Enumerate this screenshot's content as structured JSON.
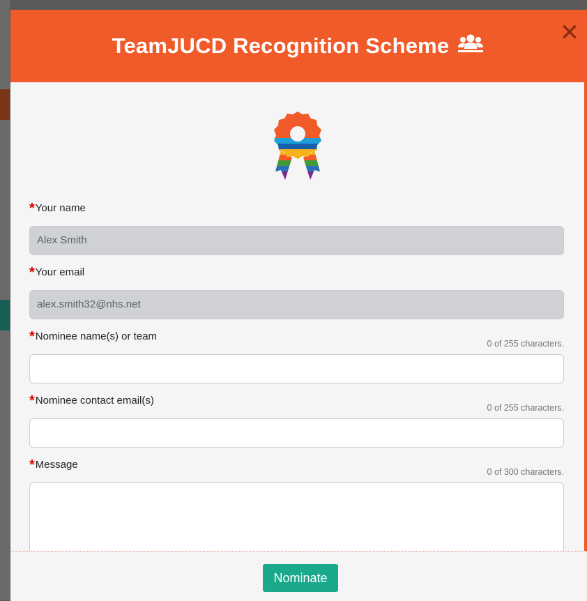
{
  "modal": {
    "title": "TeamJUCD Recognition Scheme",
    "title_icon": "users-icon",
    "close_icon": "close-icon",
    "close_symbol": "✕"
  },
  "badge_icon": "rainbow-rosette-icon",
  "form": {
    "required_marker": "*",
    "your_name": {
      "label": "Your name",
      "value": "Alex Smith"
    },
    "your_email": {
      "label": "Your email",
      "value": "alex.smith32@nhs.net"
    },
    "nominee_name": {
      "label": "Nominee name(s) or team",
      "value": "",
      "counter": "0 of 255 characters."
    },
    "nominee_email": {
      "label": "Nominee contact email(s)",
      "value": "",
      "counter": "0 of 255 characters."
    },
    "message": {
      "label": "Message",
      "value": "",
      "counter": "0 of 300 characters."
    }
  },
  "footer": {
    "nominate_label": "Nominate"
  },
  "colors": {
    "header": "#f15a29",
    "button": "#1aaa8b",
    "required": "#e00000"
  }
}
